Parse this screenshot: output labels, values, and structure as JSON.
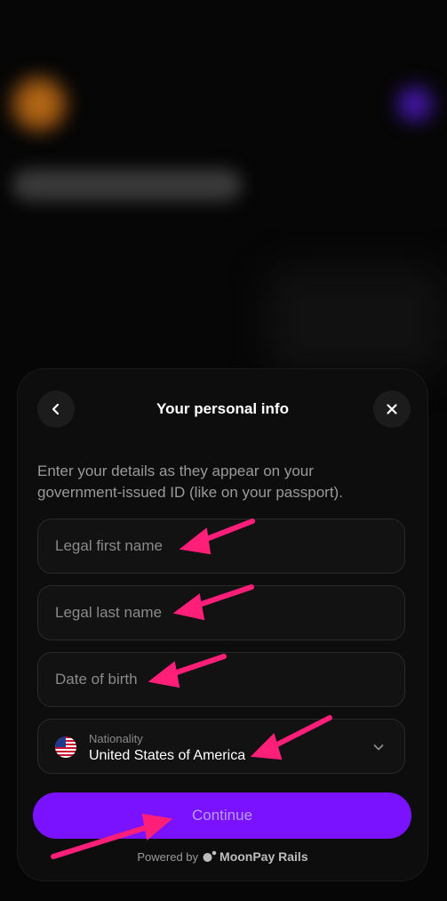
{
  "header": {
    "title": "Your personal info",
    "back_icon": "chevron-left-icon",
    "close_icon": "close-icon"
  },
  "form": {
    "instructions": "Enter your details as they appear on your government-issued ID (like on your passport).",
    "first_name": {
      "value": "",
      "placeholder": "Legal first name"
    },
    "last_name": {
      "value": "",
      "placeholder": "Legal last name"
    },
    "dob": {
      "value": "",
      "placeholder": "Date of birth"
    },
    "nationality": {
      "label": "Nationality",
      "selected": "United States of America",
      "flag_icon": "us-flag-icon"
    }
  },
  "actions": {
    "continue_label": "Continue"
  },
  "footer": {
    "powered_by": "Powered by",
    "brand": "MoonPay Rails"
  },
  "colors": {
    "accent": "#7a12ff",
    "annotation_arrow": "#ff1e78",
    "sheet_bg": "#0d0d0d"
  }
}
